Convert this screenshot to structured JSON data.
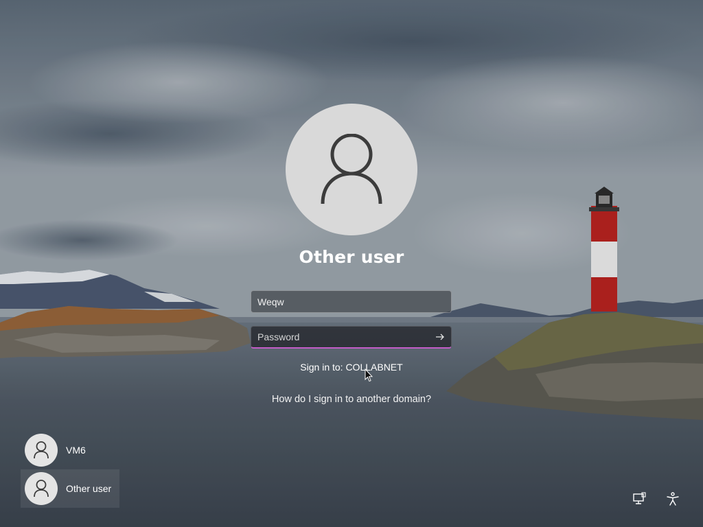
{
  "screen": "Windows sign-in screen",
  "current_user": {
    "name": "Other user",
    "avatar_icon": "person-icon"
  },
  "form": {
    "username_value": "Weqw",
    "password_placeholder": "Password",
    "submit_icon": "arrow-right-icon",
    "focus_color": "#c35cc7"
  },
  "sign_in_to": "Sign in to: COLLABNET",
  "domain_help_link": "How do I sign in to another domain?",
  "user_list": [
    {
      "name": "VM6",
      "icon": "person-icon",
      "selected": false
    },
    {
      "name": "Other user",
      "icon": "person-icon",
      "selected": true
    }
  ],
  "corner_buttons": [
    {
      "name": "network-icon"
    },
    {
      "name": "accessibility-icon"
    }
  ]
}
